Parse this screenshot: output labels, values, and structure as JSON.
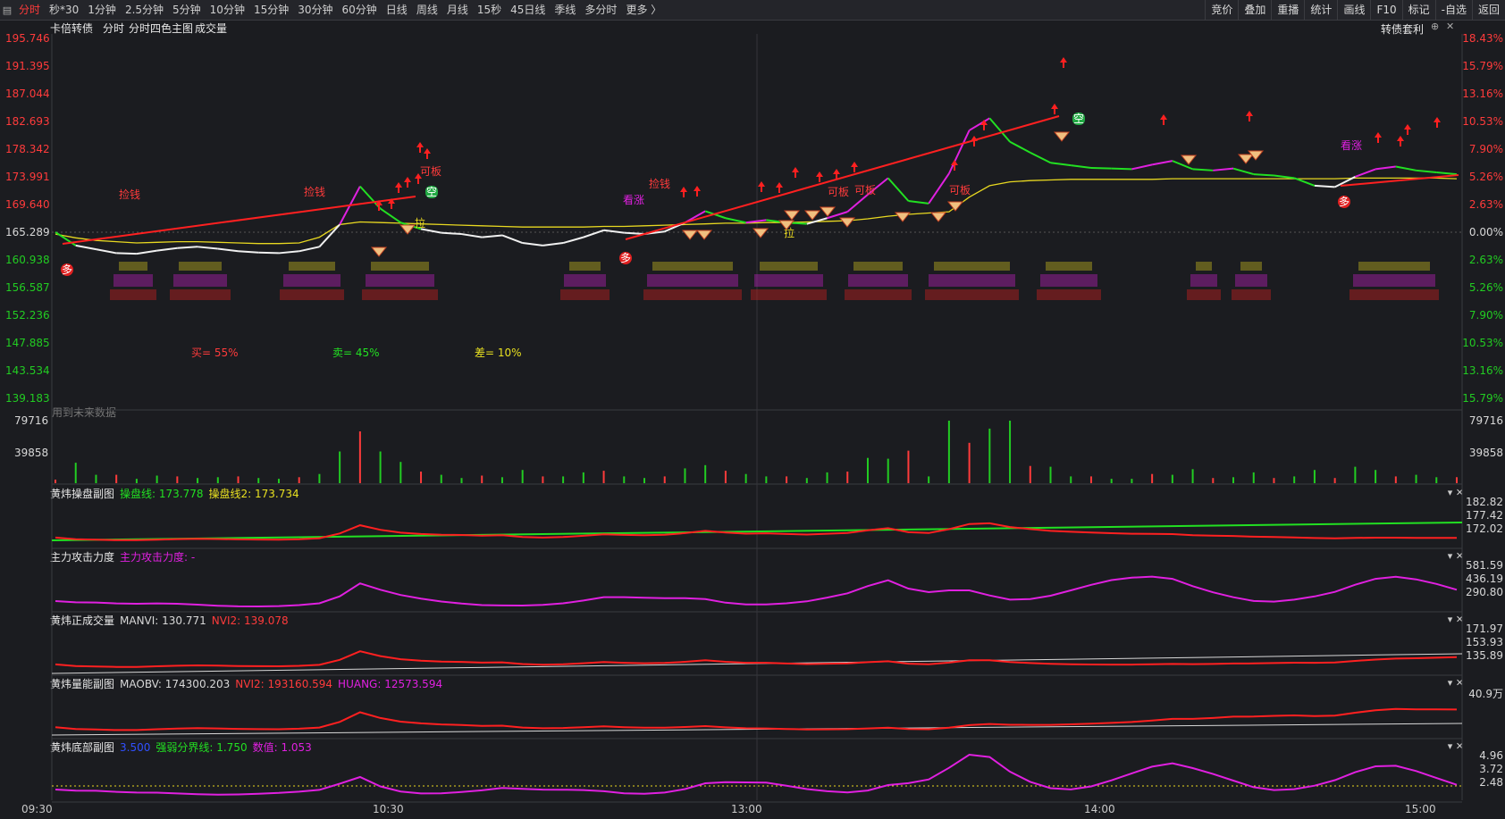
{
  "toolbar": {
    "menu_icon": "menu-icon",
    "tabs": [
      "分时",
      "秒*30",
      "1分钟",
      "2.5分钟",
      "5分钟",
      "10分钟",
      "15分钟",
      "30分钟",
      "60分钟",
      "日线",
      "周线",
      "月线",
      "15秒",
      "45日线",
      "季线",
      "多分时",
      "更多 〉"
    ],
    "active_tab": "分时",
    "right_buttons": [
      "竞价",
      "叠加",
      "重播",
      "统计",
      "画线",
      "F10",
      "标记",
      "-自选",
      "返回"
    ]
  },
  "main_header": {
    "stock_name": "卡倍转债",
    "items": [
      "分时",
      "分时四色主图",
      "成交量"
    ],
    "right_label": "转债套利"
  },
  "price_axis_left": [
    "195.746",
    "191.395",
    "187.044",
    "182.693",
    "178.342",
    "173.991",
    "169.640",
    "165.289",
    "160.938",
    "156.587",
    "152.236",
    "147.885",
    "143.534",
    "139.183"
  ],
  "pct_axis_right": [
    "18.43%",
    "15.79%",
    "13.16%",
    "10.53%",
    "7.90%",
    "5.26%",
    "2.63%",
    "0.00%",
    "2.63%",
    "5.26%",
    "7.90%",
    "10.53%",
    "13.16%",
    "15.79%"
  ],
  "pct_colors": {
    "up": "#ff3b3b",
    "flat": "#d8d8d8",
    "down": "#22cc22"
  },
  "buy_sell": {
    "buy": "买= 55%",
    "sell": "卖= 45%",
    "diff": "差= 10%"
  },
  "future_note": "用到未来数据",
  "volume_axis": {
    "left": [
      "79716",
      "39858"
    ],
    "right": [
      "79716",
      "39858"
    ]
  },
  "annotations": {
    "jianqian": "捡钱",
    "kanzhang": "看涨",
    "keban": "可板",
    "la": "拉",
    "kong": "空",
    "duo": "多"
  },
  "panels": [
    {
      "title": "黄炜操盘副图",
      "fields": [
        {
          "text": "操盘线: 173.778",
          "color": "#22e022"
        },
        {
          "text": "操盘线2: 173.734",
          "color": "#e8e020"
        }
      ],
      "axis": [
        "182.82",
        "177.42",
        "172.02"
      ]
    },
    {
      "title": "主力攻击力度",
      "fields": [
        {
          "text": "主力攻击力度: -",
          "color": "#e020e0"
        }
      ],
      "axis": [
        "581.59",
        "436.19",
        "290.80"
      ]
    },
    {
      "title": "黄炜正成交量",
      "fields": [
        {
          "text": "MANVI: 130.771",
          "color": "#d8d8d8"
        },
        {
          "text": "NVI2: 139.078",
          "color": "#ff3b3b"
        }
      ],
      "axis": [
        "171.97",
        "153.93",
        "135.89"
      ]
    },
    {
      "title": "黄炜量能副图",
      "fields": [
        {
          "text": "MAOBV: 174300.203",
          "color": "#d8d8d8"
        },
        {
          "text": "NVI2: 193160.594",
          "color": "#ff3b3b"
        },
        {
          "text": "HUANG: 12573.594",
          "color": "#e020e0"
        }
      ],
      "axis": [
        "40.9万"
      ]
    },
    {
      "title": "黄炜底部副图",
      "fields": [
        {
          "text": "3.500",
          "color": "#3050ff"
        },
        {
          "text": "强弱分界线: 1.750",
          "color": "#22e022"
        },
        {
          "text": "数值: 1.053",
          "color": "#e020e0"
        }
      ],
      "axis": [
        "4.96",
        "3.72",
        "2.48"
      ]
    }
  ],
  "time_axis": [
    "09:30",
    "10:30",
    "13:00",
    "14:00",
    "15:00"
  ],
  "chart_data": {
    "type": "line",
    "title": "卡倍转债",
    "ylim": [
      139.183,
      195.746
    ],
    "y_ticks": [
      195.746,
      191.395,
      187.044,
      182.693,
      178.342,
      173.991,
      169.64,
      165.289,
      160.938,
      156.587,
      152.236,
      147.885,
      143.534,
      139.183
    ],
    "x_ticks": [
      "09:30",
      "10:30",
      "13:00",
      "14:00",
      "15:00"
    ],
    "series": [
      {
        "values": [
          165.3,
          163.2,
          162.6,
          162.0,
          161.9,
          162.4,
          162.8,
          163.0,
          162.7,
          162.3,
          162.1,
          162.0,
          162.3,
          163.0,
          166.5,
          172.5,
          169.0,
          166.8,
          165.8,
          165.2,
          165.0,
          164.5,
          164.8,
          163.6,
          163.2,
          163.6,
          164.5,
          165.6,
          165.2,
          165.0,
          165.4,
          166.8,
          168.6,
          167.5,
          166.8,
          167.2,
          166.8,
          166.6,
          167.5,
          168.5,
          171.2,
          173.8,
          170.2,
          169.8,
          174.5,
          181.3,
          183.2,
          179.5,
          177.8,
          176.2,
          175.8,
          175.4,
          175.3,
          175.2,
          175.9,
          176.5,
          175.2,
          175.0,
          175.3,
          174.4,
          174.2,
          173.8,
          172.6,
          172.4,
          174.0,
          175.2,
          175.6,
          175.0,
          174.7,
          174.4
        ]
      },
      {
        "values": [
          165.0,
          164.4,
          164.0,
          163.8,
          163.6,
          163.7,
          163.8,
          163.8,
          163.7,
          163.6,
          163.5,
          163.5,
          163.6,
          164.5,
          166.5,
          166.9,
          166.8,
          166.7,
          166.6,
          166.5,
          166.4,
          166.3,
          166.2,
          166.1,
          166.1,
          166.1,
          166.1,
          166.2,
          166.2,
          166.3,
          166.4,
          166.5,
          166.6,
          166.7,
          166.7,
          166.8,
          166.8,
          166.9,
          167.0,
          167.1,
          167.4,
          167.8,
          168.1,
          168.3,
          168.5,
          170.8,
          172.6,
          173.2,
          173.4,
          173.5,
          173.6,
          173.6,
          173.6,
          173.6,
          173.6,
          173.7,
          173.7,
          173.7,
          173.7,
          173.7,
          173.7,
          173.7,
          173.7,
          173.7,
          173.8,
          173.8,
          173.8,
          173.8,
          173.8,
          173.7
        ]
      }
    ]
  }
}
